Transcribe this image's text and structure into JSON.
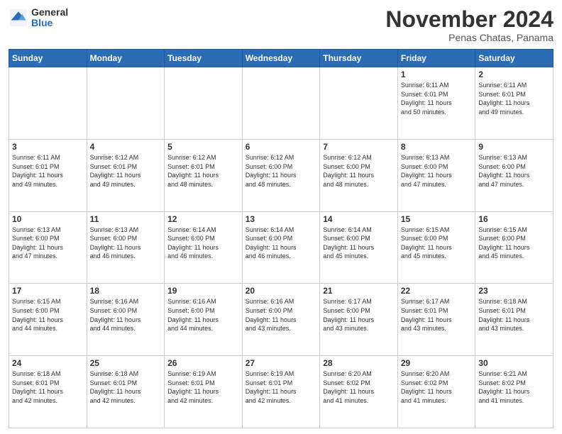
{
  "header": {
    "logo_general": "General",
    "logo_blue": "Blue",
    "month_title": "November 2024",
    "location": "Penas Chatas, Panama"
  },
  "days_of_week": [
    "Sunday",
    "Monday",
    "Tuesday",
    "Wednesday",
    "Thursday",
    "Friday",
    "Saturday"
  ],
  "weeks": [
    [
      {
        "day": "",
        "info": ""
      },
      {
        "day": "",
        "info": ""
      },
      {
        "day": "",
        "info": ""
      },
      {
        "day": "",
        "info": ""
      },
      {
        "day": "",
        "info": ""
      },
      {
        "day": "1",
        "info": "Sunrise: 6:11 AM\nSunset: 6:01 PM\nDaylight: 11 hours\nand 50 minutes."
      },
      {
        "day": "2",
        "info": "Sunrise: 6:11 AM\nSunset: 6:01 PM\nDaylight: 11 hours\nand 49 minutes."
      }
    ],
    [
      {
        "day": "3",
        "info": "Sunrise: 6:11 AM\nSunset: 6:01 PM\nDaylight: 11 hours\nand 49 minutes."
      },
      {
        "day": "4",
        "info": "Sunrise: 6:12 AM\nSunset: 6:01 PM\nDaylight: 11 hours\nand 49 minutes."
      },
      {
        "day": "5",
        "info": "Sunrise: 6:12 AM\nSunset: 6:01 PM\nDaylight: 11 hours\nand 48 minutes."
      },
      {
        "day": "6",
        "info": "Sunrise: 6:12 AM\nSunset: 6:00 PM\nDaylight: 11 hours\nand 48 minutes."
      },
      {
        "day": "7",
        "info": "Sunrise: 6:12 AM\nSunset: 6:00 PM\nDaylight: 11 hours\nand 48 minutes."
      },
      {
        "day": "8",
        "info": "Sunrise: 6:13 AM\nSunset: 6:00 PM\nDaylight: 11 hours\nand 47 minutes."
      },
      {
        "day": "9",
        "info": "Sunrise: 6:13 AM\nSunset: 6:00 PM\nDaylight: 11 hours\nand 47 minutes."
      }
    ],
    [
      {
        "day": "10",
        "info": "Sunrise: 6:13 AM\nSunset: 6:00 PM\nDaylight: 11 hours\nand 47 minutes."
      },
      {
        "day": "11",
        "info": "Sunrise: 6:13 AM\nSunset: 6:00 PM\nDaylight: 11 hours\nand 46 minutes."
      },
      {
        "day": "12",
        "info": "Sunrise: 6:14 AM\nSunset: 6:00 PM\nDaylight: 11 hours\nand 46 minutes."
      },
      {
        "day": "13",
        "info": "Sunrise: 6:14 AM\nSunset: 6:00 PM\nDaylight: 11 hours\nand 46 minutes."
      },
      {
        "day": "14",
        "info": "Sunrise: 6:14 AM\nSunset: 6:00 PM\nDaylight: 11 hours\nand 45 minutes."
      },
      {
        "day": "15",
        "info": "Sunrise: 6:15 AM\nSunset: 6:00 PM\nDaylight: 11 hours\nand 45 minutes."
      },
      {
        "day": "16",
        "info": "Sunrise: 6:15 AM\nSunset: 6:00 PM\nDaylight: 11 hours\nand 45 minutes."
      }
    ],
    [
      {
        "day": "17",
        "info": "Sunrise: 6:15 AM\nSunset: 6:00 PM\nDaylight: 11 hours\nand 44 minutes."
      },
      {
        "day": "18",
        "info": "Sunrise: 6:16 AM\nSunset: 6:00 PM\nDaylight: 11 hours\nand 44 minutes."
      },
      {
        "day": "19",
        "info": "Sunrise: 6:16 AM\nSunset: 6:00 PM\nDaylight: 11 hours\nand 44 minutes."
      },
      {
        "day": "20",
        "info": "Sunrise: 6:16 AM\nSunset: 6:00 PM\nDaylight: 11 hours\nand 43 minutes."
      },
      {
        "day": "21",
        "info": "Sunrise: 6:17 AM\nSunset: 6:00 PM\nDaylight: 11 hours\nand 43 minutes."
      },
      {
        "day": "22",
        "info": "Sunrise: 6:17 AM\nSunset: 6:01 PM\nDaylight: 11 hours\nand 43 minutes."
      },
      {
        "day": "23",
        "info": "Sunrise: 6:18 AM\nSunset: 6:01 PM\nDaylight: 11 hours\nand 43 minutes."
      }
    ],
    [
      {
        "day": "24",
        "info": "Sunrise: 6:18 AM\nSunset: 6:01 PM\nDaylight: 11 hours\nand 42 minutes."
      },
      {
        "day": "25",
        "info": "Sunrise: 6:18 AM\nSunset: 6:01 PM\nDaylight: 11 hours\nand 42 minutes."
      },
      {
        "day": "26",
        "info": "Sunrise: 6:19 AM\nSunset: 6:01 PM\nDaylight: 11 hours\nand 42 minutes."
      },
      {
        "day": "27",
        "info": "Sunrise: 6:19 AM\nSunset: 6:01 PM\nDaylight: 11 hours\nand 42 minutes."
      },
      {
        "day": "28",
        "info": "Sunrise: 6:20 AM\nSunset: 6:02 PM\nDaylight: 11 hours\nand 41 minutes."
      },
      {
        "day": "29",
        "info": "Sunrise: 6:20 AM\nSunset: 6:02 PM\nDaylight: 11 hours\nand 41 minutes."
      },
      {
        "day": "30",
        "info": "Sunrise: 6:21 AM\nSunset: 6:02 PM\nDaylight: 11 hours\nand 41 minutes."
      }
    ]
  ]
}
